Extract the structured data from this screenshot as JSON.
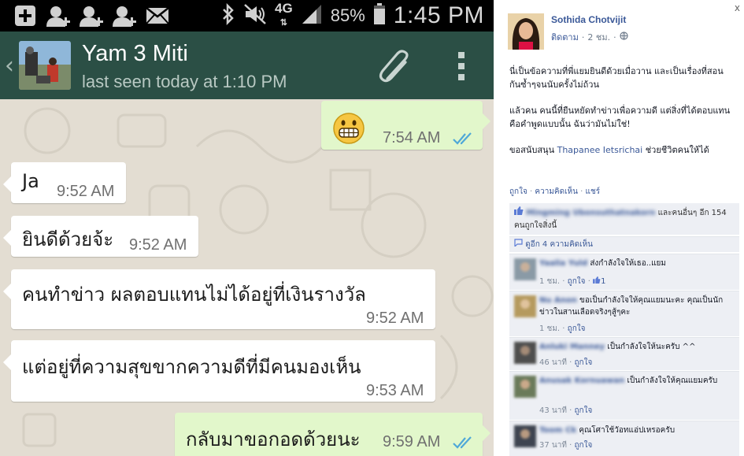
{
  "status_bar": {
    "battery_percent": "85%",
    "network": "4G",
    "time": "1:45 PM",
    "battery_level": 0.85,
    "left_icons": [
      "add-icon",
      "add-contact-icon",
      "add-contact-icon",
      "add-contact-icon",
      "mail-icon"
    ],
    "right_icons": [
      "bluetooth-icon",
      "mute-icon",
      "signal-icon",
      "battery-icon"
    ]
  },
  "chat_header": {
    "contact_name": "Yam 3 Miti",
    "last_seen": "last seen today at 1:10 PM",
    "header_color": "#2b4f45"
  },
  "messages": [
    {
      "direction": "out",
      "text": "😬",
      "time": "7:54 AM",
      "read": true
    },
    {
      "direction": "in",
      "text": "Ja",
      "time": "9:52 AM"
    },
    {
      "direction": "in",
      "text": "ยินดีด้วยจ้ะ",
      "time": "9:52 AM"
    },
    {
      "direction": "in",
      "text": "คนทำข่าว ผลตอบแทนไม่ได้อยู่ที่เงินรางวัล",
      "time": "9:52 AM"
    },
    {
      "direction": "in",
      "text": "แต่อยู่ที่ความสุขขากความดีที่มีคนมองเห็น",
      "time": "9:53 AM"
    },
    {
      "direction": "out",
      "text": "กลับมาขอกอดด้วยนะ",
      "time": "9:59 AM",
      "read": true
    }
  ],
  "fb": {
    "author": "Sothida Chotvijit",
    "meta_follow": "ติดตาม",
    "meta_time": "2 ชม.",
    "close": "x",
    "post": {
      "p1": "นี่เป็นข้อความที่พี่แยมยินดีด้วยเมื่อวาน และเป็นเรื่องที่สอนกันซ้ำๆจนนับครั้งไม่ถ้วน",
      "p2": "แล้วคน คนนี้ที่ยืนหยัดทำข่าวเพื่อความดี แต่สิ่งที่ได้ตอบแทนคือคำพูดแบบนั้น ฉันว่ามันไม่ใช่!",
      "p3_prefix": "ขอสนับสนุน",
      "p3_link": "Thapanee Ietsrichai",
      "p3_suffix": "ช่วยชีวิตคนให้ได้"
    },
    "actions": {
      "like": "ถูกใจ",
      "comment": "ความคิดเห็น",
      "share": "แชร์",
      "sep": "·"
    },
    "likes": {
      "blurred_name": "Mingming Ubonsuthatnakorn",
      "text": "และคนอื่นๆ อีก 154 คนถูกใจสิ่งนี้",
      "others": "คนอื่นๆ อีก 154"
    },
    "more_comments": "ดูอีก 4 ความคิดเห็น",
    "comments": [
      {
        "name": "Yaalia Yuld",
        "text": "ส่งกำลังใจให้เธอ..แยม",
        "time": "1 ชม.",
        "like": "ถูกใจ",
        "likes": "1"
      },
      {
        "name": "Nu Anon",
        "text": "ขอเป็นกำลังใจให้คุณแยมนะคะ คุณเป็นนักข่าวในสานเลือดจริงๆสู้ๆคะ",
        "time": "1 ชม.",
        "like": "ถูกใจ"
      },
      {
        "name": "Anluki Manney",
        "text": "เป็นกำลังใจให้นะครับ ^^",
        "time": "46 นาที",
        "like": "ถูกใจ"
      },
      {
        "name": "Anusak Kornuawan",
        "text": "เป็นกำลังใจให้คุณแยมครับ",
        "time": "43 นาที",
        "like": "ถูกใจ"
      },
      {
        "name": "Toom Ck",
        "text": "คุณโศาใช้วัอทแอ่ปเหรอครับ",
        "time": "37 นาที",
        "like": "ถูกใจ"
      }
    ],
    "link_color": "#3b5998"
  }
}
